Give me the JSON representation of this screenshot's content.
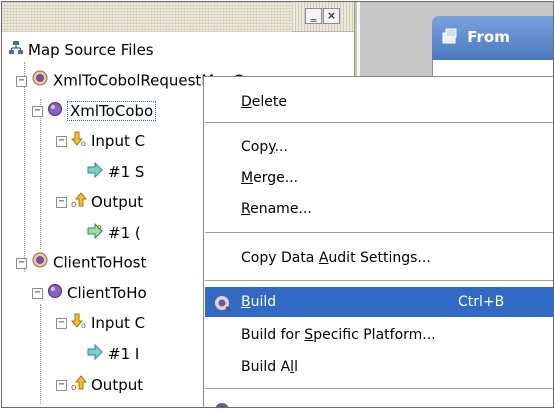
{
  "tree": {
    "root_label": "Map Source Files",
    "items": [
      {
        "label": "XmlToCobolRequestMapC",
        "level": 1
      },
      {
        "label": "XmlToCobo",
        "level": 2
      },
      {
        "label": "Input C",
        "level": 3
      },
      {
        "label": "#1 S",
        "level": 4
      },
      {
        "label": "Output",
        "level": 3
      },
      {
        "label": "#1 (",
        "level": 4
      },
      {
        "label": "ClientToHost",
        "level": 1
      },
      {
        "label": "ClientToHo",
        "level": 2
      },
      {
        "label": "Input C",
        "level": 3
      },
      {
        "label": "#1 I",
        "level": 4
      },
      {
        "label": "Output",
        "level": 3
      }
    ]
  },
  "right_panel": {
    "title": "From"
  },
  "context_menu": {
    "items": [
      {
        "label_pre": "",
        "mnemonic": "D",
        "label_post": "elete"
      },
      {
        "label_pre": "Cop",
        "mnemonic": "y",
        "label_post": "..."
      },
      {
        "label_pre": "",
        "mnemonic": "M",
        "label_post": "erge..."
      },
      {
        "label_pre": "",
        "mnemonic": "R",
        "label_post": "ename..."
      },
      {
        "label_pre": "Copy Data ",
        "mnemonic": "A",
        "label_post": "udit Settings..."
      },
      {
        "label_pre": "",
        "mnemonic": "B",
        "label_post": "uild",
        "accelerator": "Ctrl+B"
      },
      {
        "label_pre": "Build for ",
        "mnemonic": "S",
        "label_post": "pecific Platform..."
      },
      {
        "label_pre": "Build A",
        "mnemonic": "l",
        "label_post": "l"
      }
    ]
  },
  "colors": {
    "menu_highlight": "#316ac5",
    "from_header": "#4b78c2"
  }
}
